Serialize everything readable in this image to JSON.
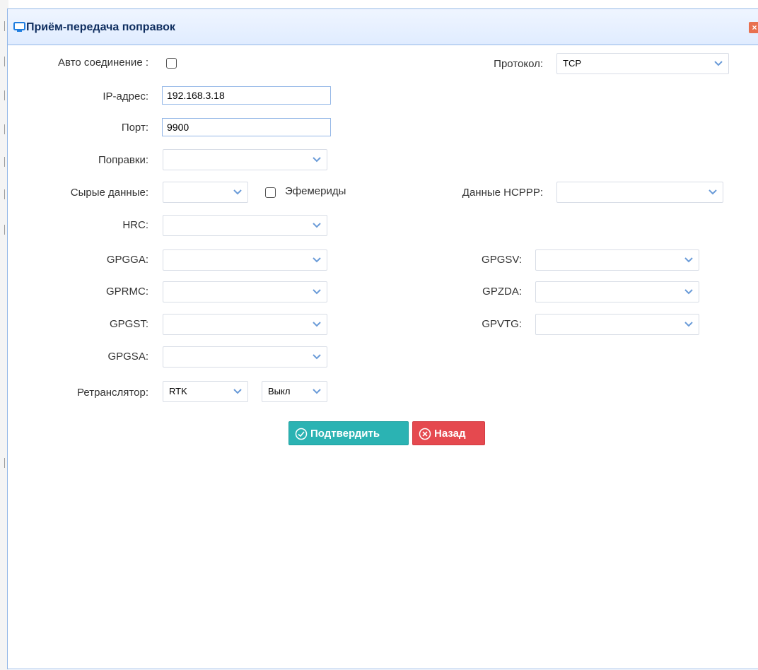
{
  "dialog": {
    "title": "Приём-передача поправок",
    "title_icon": "monitor-icon",
    "close_icon": "close-icon",
    "accent_color": "#95b8e7"
  },
  "form": {
    "auto_connect": {
      "label": "Авто соединение :",
      "checked": false
    },
    "protocol": {
      "label": "Протокол:",
      "value": "TCP"
    },
    "ip": {
      "label": "IP-адрес:",
      "value": "192.168.3.18"
    },
    "port": {
      "label": "Порт:",
      "value": "9900"
    },
    "corrections": {
      "label": "Поправки:",
      "value": ""
    },
    "raw_data": {
      "label": "Сырые данные:",
      "value": ""
    },
    "ephemeris": {
      "label": "Эфемериды",
      "checked": false
    },
    "hcppp": {
      "label": "Данные HCPPP:",
      "value": ""
    },
    "hrc": {
      "label": "HRC:",
      "value": ""
    },
    "gpgga": {
      "label": "GPGGA:",
      "value": ""
    },
    "gpgsv": {
      "label": "GPGSV:",
      "value": ""
    },
    "gprmc": {
      "label": "GPRMC:",
      "value": ""
    },
    "gpzda": {
      "label": "GPZDA:",
      "value": ""
    },
    "gpgst": {
      "label": "GPGST:",
      "value": ""
    },
    "gpvtg": {
      "label": "GPVTG:",
      "value": ""
    },
    "gpgsa": {
      "label": "GPGSA:",
      "value": ""
    },
    "repeater": {
      "label": "Ретранслятор:",
      "mode": "RTK",
      "state": "Выкл"
    }
  },
  "buttons": {
    "confirm": {
      "label": "Подтвердить",
      "icon": "check-circle-icon",
      "color": "#2bb3b3"
    },
    "back": {
      "label": "Назад",
      "icon": "x-circle-icon",
      "color": "#e5494f"
    }
  }
}
